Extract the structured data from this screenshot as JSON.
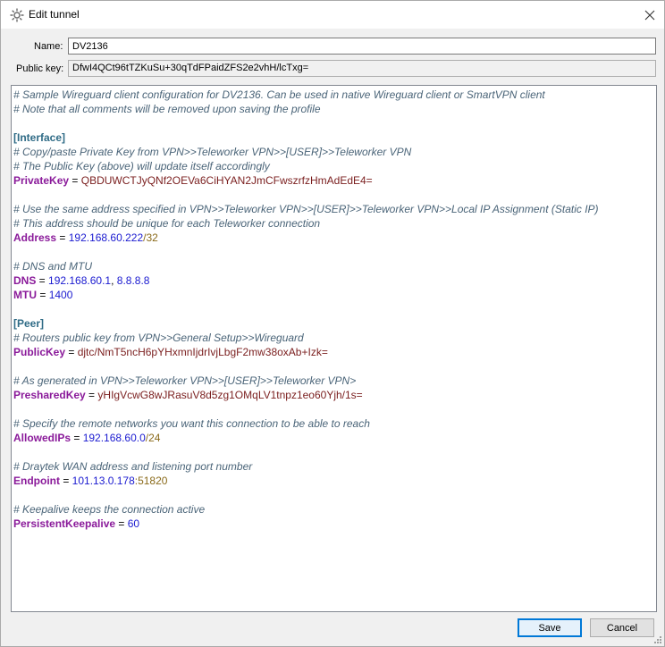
{
  "window": {
    "title": "Edit tunnel",
    "icon": "gear-icon"
  },
  "form": {
    "name_label": "Name:",
    "name_value": "DV2136",
    "public_key_label": "Public key:",
    "public_key_value": "DfwI4QCt96tTZKuSu+30qTdFPaidZFS2e2vhH/lcTxg="
  },
  "config": {
    "l0": "# Sample Wireguard client configuration for DV2136. Can be used in native Wireguard client or SmartVPN client",
    "l1": "# Note that all comments will be removed upon saving the profile",
    "l3": "[Interface]",
    "l4": "# Copy/paste Private Key from VPN>>Teleworker VPN>>[USER]>>Teleworker VPN",
    "l5": "# The Public Key (above) will update itself accordingly",
    "l6k": "PrivateKey",
    "l6v": "QBDUWCTJyQNf2OEVa6CiHYAN2JmCFwszrfzHmAdEdE4=",
    "l8": "# Use the same address specified in VPN>>Teleworker VPN>>[USER]>>Teleworker VPN>>Local IP Assignment (Static IP)",
    "l9": "# This address should be unique for each Teleworker connection",
    "l10k": "Address",
    "l10v": "192.168.60.222",
    "l10s": "/32",
    "l12": "# DNS and MTU",
    "l13k": "DNS",
    "l13v": "192.168.60.1",
    "l13v2": "8.8.8.8",
    "l14k": "MTU",
    "l14v": "1400",
    "l16": "[Peer]",
    "l17": "# Routers public key from VPN>>General Setup>>Wireguard",
    "l18k": "PublicKey",
    "l18v": "djtc/NmT5ncH6pYHxmnIjdrIvjLbgF2mw38oxAb+Izk=",
    "l20": "# As generated in VPN>>Teleworker VPN>>[USER]>>Teleworker VPN>",
    "l21k": "PresharedKey",
    "l21v": "yHIgVcwG8wJRasuV8d5zg1OMqLV1tnpz1eo60Yjh/1s=",
    "l23": "# Specify the remote networks you want this connection to be able to reach",
    "l24k": "AllowedIPs",
    "l24v": "192.168.60.0",
    "l24s": "/24",
    "l26": "# Draytek WAN address and listening port number",
    "l27k": "Endpoint",
    "l27v": "101.13.0.178",
    "l27s": ":51820",
    "l29": "# Keepalive keeps the connection active",
    "l30k": "PersistentKeepalive",
    "l30v": "60",
    "eq": " = ",
    "comma": ", "
  },
  "buttons": {
    "save": "Save",
    "cancel": "Cancel"
  }
}
